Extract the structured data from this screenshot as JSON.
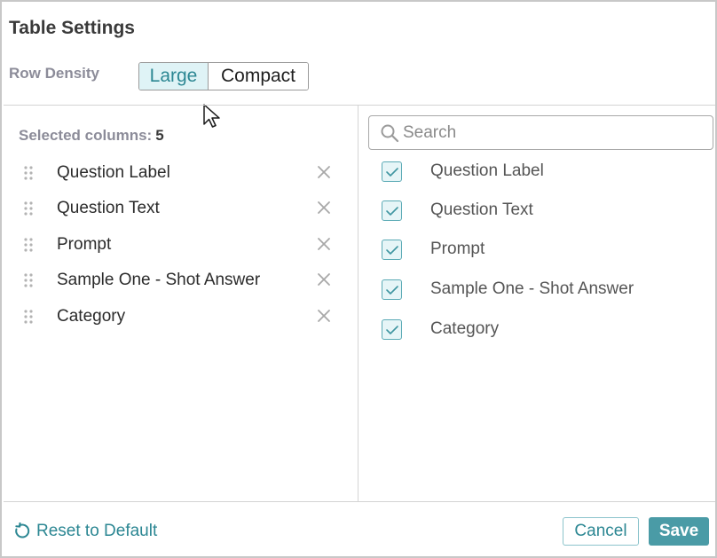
{
  "dialog": {
    "title": "Table Settings"
  },
  "density": {
    "label": "Row Density",
    "options": [
      "Large",
      "Compact"
    ],
    "selected": "Large"
  },
  "selected_panel": {
    "header": "Selected columns:",
    "count": "5",
    "items": [
      {
        "label": "Question Label",
        "drag_icon": "drag-handle-icon",
        "remove_icon": "close-icon"
      },
      {
        "label": "Question Text",
        "drag_icon": "drag-handle-icon",
        "remove_icon": "close-icon"
      },
      {
        "label": "Prompt",
        "drag_icon": "drag-handle-icon",
        "remove_icon": "close-icon"
      },
      {
        "label": "Sample One - Shot Answer",
        "drag_icon": "drag-handle-icon",
        "remove_icon": "close-icon"
      },
      {
        "label": "Category",
        "drag_icon": "drag-handle-icon",
        "remove_icon": "close-icon"
      }
    ]
  },
  "options_panel": {
    "search": {
      "placeholder": "Search",
      "value": ""
    },
    "items": [
      {
        "label": "Question Label",
        "checked": true
      },
      {
        "label": "Question Text",
        "checked": true
      },
      {
        "label": "Prompt",
        "checked": true
      },
      {
        "label": "Sample One - Shot Answer",
        "checked": true
      },
      {
        "label": "Category",
        "checked": true
      }
    ]
  },
  "footer": {
    "reset_label": "Reset to Default",
    "cancel_label": "Cancel",
    "save_label": "Save"
  },
  "colors": {
    "accent": "#2c8793",
    "accent_fill": "#4a9ba6",
    "selected_segment_bg": "#dff3f6",
    "checkbox_bg": "#e6f5f7",
    "muted_label": "#8c8c99"
  }
}
